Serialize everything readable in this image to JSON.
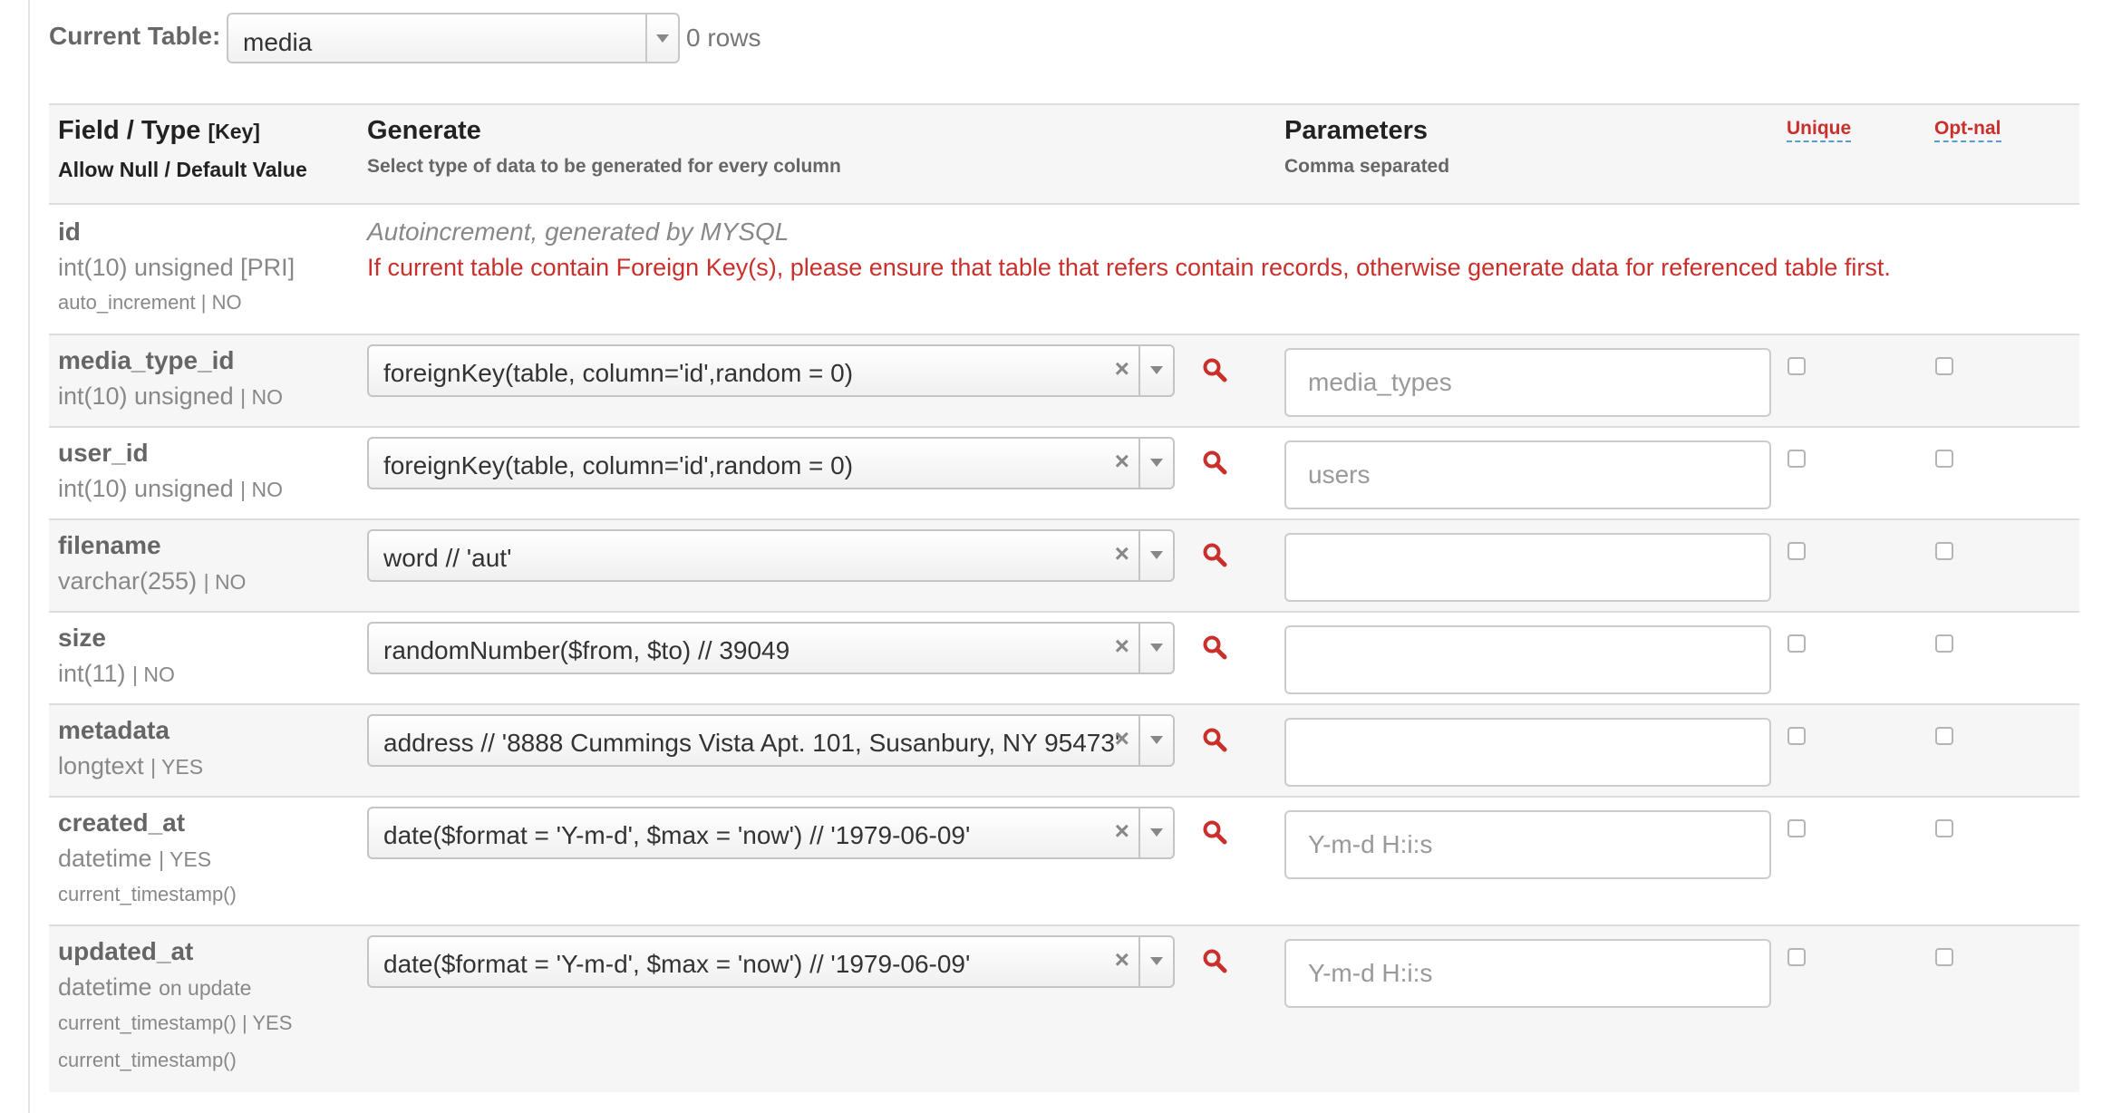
{
  "toolbar": {
    "current_table_label": "Current Table:",
    "current_table_value": "media",
    "rows_count": "0 rows"
  },
  "header": {
    "field_type": "Field / Type",
    "key": "[Key]",
    "allow_null_default": "Allow Null / Default Value",
    "generate": "Generate",
    "generate_sub": "Select type of data to be generated for every column",
    "parameters": "Parameters",
    "parameters_sub": "Comma separated",
    "unique": "Unique",
    "optional": "Opt-nal"
  },
  "rows": [
    {
      "name": "id",
      "type": "int(10) unsigned [PRI]",
      "extra": "auto_increment | NO",
      "note_auto": "Autoincrement, generated by MYSQL",
      "note_fk": "If current table contain Foreign Key(s), please ensure that table that refers contain records, otherwise generate data for referenced table first."
    },
    {
      "name": "media_type_id",
      "type": "int(10) unsigned",
      "meta": "| NO",
      "generator": "foreignKey(table, column='id',random = 0)",
      "param_placeholder": "media_types"
    },
    {
      "name": "user_id",
      "type": "int(10) unsigned",
      "meta": "| NO",
      "generator": "foreignKey(table, column='id',random = 0)",
      "param_placeholder": "users"
    },
    {
      "name": "filename",
      "type": "varchar(255)",
      "meta": "| NO",
      "generator": "word // 'aut'",
      "param_placeholder": ""
    },
    {
      "name": "size",
      "type": "int(11)",
      "meta": "| NO",
      "generator": "randomNumber($from, $to) // 39049",
      "param_placeholder": ""
    },
    {
      "name": "metadata",
      "type": "longtext",
      "meta": "| YES",
      "generator": "address // '8888 Cummings Vista Apt. 101, Susanbury, NY 95473'",
      "param_placeholder": ""
    },
    {
      "name": "created_at",
      "type": "datetime",
      "meta": "| YES",
      "extra": "current_timestamp()",
      "generator": "date($format = 'Y-m-d', $max = 'now') // '1979-06-09'",
      "param_placeholder": "Y-m-d H:i:s"
    },
    {
      "name": "updated_at",
      "type": "datetime",
      "meta": "on update",
      "extra": "current_timestamp() | YES",
      "extra2": "current_timestamp()",
      "generator": "date($format = 'Y-m-d', $max = 'now') // '1979-06-09'",
      "param_placeholder": "Y-m-d H:i:s"
    }
  ],
  "icons": {
    "dropdown": "chevron-down-icon",
    "clear": "clear-x-icon",
    "search": "search-icon"
  },
  "colors": {
    "accent_red": "#c9302c",
    "header_bg": "#f6f6f6",
    "border": "#dddddd"
  }
}
